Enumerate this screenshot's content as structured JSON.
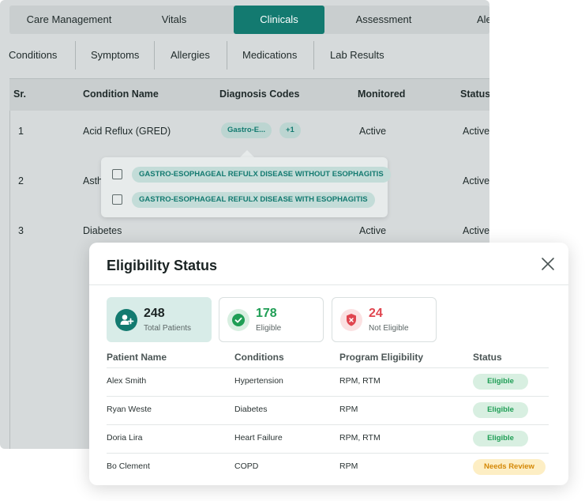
{
  "main_tabs": [
    {
      "label": "Care Management"
    },
    {
      "label": "Vitals"
    },
    {
      "label": "Clinicals",
      "active": true
    },
    {
      "label": "Assessment"
    },
    {
      "label": "Ale"
    }
  ],
  "sub_tabs": [
    {
      "label": "Conditions"
    },
    {
      "label": "Symptoms"
    },
    {
      "label": "Allergies"
    },
    {
      "label": "Medications"
    },
    {
      "label": "Lab Results"
    }
  ],
  "conditions_table": {
    "headers": [
      "Sr.",
      "Condition Name",
      "Diagnosis Codes",
      "Monitored",
      "Status"
    ],
    "rows": [
      {
        "sr": "1",
        "name": "Acid Reflux (GRED)",
        "code": "Gastro-E...",
        "more": "+1",
        "monitored": "Active",
        "status": "Active"
      },
      {
        "sr": "2",
        "name": "Asth",
        "monitored": "",
        "status": "Active"
      },
      {
        "sr": "3",
        "name": "Diabetes",
        "monitored": "Active",
        "status": "Active"
      }
    ]
  },
  "diagnosis_popover": {
    "options": [
      "GASTRO-ESOPHAGEAL REFULX DISEASE WITHOUT ESOPHAGITIS",
      "GASTRO-ESOPHAGEAL REFULX DISEASE WITH ESOPHAGITIS"
    ]
  },
  "modal": {
    "title": "Eligibility Status",
    "stats": [
      {
        "value": "248",
        "label": "Total Patients",
        "color": "#1a2323"
      },
      {
        "value": "178",
        "label": "Eligible",
        "color": "#1f9e55"
      },
      {
        "value": "24",
        "label": "Not Eligible",
        "color": "#e0454f"
      }
    ],
    "headers": [
      "Patient Name",
      "Conditions",
      "Program Eligibility",
      "Status"
    ],
    "rows": [
      {
        "name": "Alex Smith",
        "condition": "Hypertension",
        "program": "RPM, RTM",
        "status": "Eligible"
      },
      {
        "name": "Ryan Weste",
        "condition": "Diabetes",
        "program": "RPM",
        "status": "Eligible"
      },
      {
        "name": "Doria Lira",
        "condition": "Heart Failure",
        "program": "RPM, RTM",
        "status": "Eligible"
      },
      {
        "name": "Bo Clement",
        "condition": "COPD",
        "program": "RPM",
        "status": "Needs Review"
      }
    ]
  },
  "colors": {
    "accent": "#137a70",
    "eligible_bg": "#d8efe1",
    "eligible_text": "#1f9e55",
    "review_bg": "#fdeec4",
    "review_text": "#d48806"
  },
  "icons": {
    "close": "close-icon",
    "add_user": "add-user-icon",
    "check_circle": "check-circle-icon",
    "shield_x": "shield-x-icon"
  }
}
